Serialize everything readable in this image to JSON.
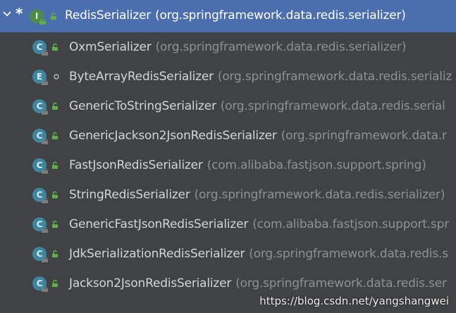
{
  "root": {
    "marker": "*",
    "icon": "interface",
    "icon_letter": "I",
    "name": "RedisSerializer",
    "pkg": "(org.springframework.data.redis.serializer)"
  },
  "children": [
    {
      "icon": "class",
      "icon_letter": "C",
      "name": "OxmSerializer",
      "pkg": "(org.springframework.data.redis.serializer)"
    },
    {
      "icon": "enum",
      "icon_letter": "E",
      "name": "ByteArrayRedisSerializer",
      "pkg": "(org.springframework.data.redis.serializ"
    },
    {
      "icon": "class",
      "icon_letter": "C",
      "name": "GenericToStringSerializer",
      "pkg": "(org.springframework.data.redis.serial"
    },
    {
      "icon": "class",
      "icon_letter": "C",
      "name": "GenericJackson2JsonRedisSerializer",
      "pkg": "(org.springframework.data.r"
    },
    {
      "icon": "class",
      "icon_letter": "C",
      "name": "FastJsonRedisSerializer",
      "pkg": "(com.alibaba.fastjson.support.spring)"
    },
    {
      "icon": "class",
      "icon_letter": "C",
      "name": "StringRedisSerializer",
      "pkg": "(org.springframework.data.redis.serializer)"
    },
    {
      "icon": "class",
      "icon_letter": "C",
      "name": "GenericFastJsonRedisSerializer",
      "pkg": "(com.alibaba.fastjson.support.spr"
    },
    {
      "icon": "class",
      "icon_letter": "C",
      "name": "JdkSerializationRedisSerializer",
      "pkg": "(org.springframework.data.redis.s"
    },
    {
      "icon": "class",
      "icon_letter": "C",
      "name": "Jackson2JsonRedisSerializer",
      "pkg": "(org.springframework.data.redis.ser"
    }
  ],
  "watermark": "https://blog.csdn.net/yangshangwei",
  "colors": {
    "selection": "#4b6eaf",
    "background": "#414244",
    "name_text": "#d3d5d7",
    "package_text": "#8f9193",
    "class_icon": "#3e86a0",
    "interface_icon": "#4c8c47",
    "public_lock": "#5fb049"
  }
}
